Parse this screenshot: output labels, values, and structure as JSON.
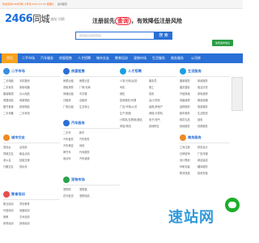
{
  "topbar": {
    "text": "欢迎来到2466同城 小号请 2021-07-09 星期六",
    "link": "设为首页"
  },
  "logo": {
    "brand": "2466",
    "tail": "同城"
  },
  "city": {
    "label": "· 曲阳 切换"
  },
  "banner": {
    "prefix": "注册前先",
    "highlight": "查询",
    "suffix": "，有效降低注册风险"
  },
  "search": {
    "placeholder": "搜索信息关键词查找",
    "button": "搜 索"
  },
  "post": {
    "label": "免费发布信息"
  },
  "nav": [
    "首页",
    "二手市场",
    "汽车服务",
    "房屋租售",
    "人才招聘",
    "城市交友",
    "教育培训",
    "宠物市场",
    "生活服务",
    "商务服务",
    "公司库"
  ],
  "sections": {
    "ershou": {
      "title": "二手市场",
      "links": [
        "二手电脑",
        "手机数码",
        "二手家具",
        "家用电器",
        "服装鞋帽",
        "办公用品",
        "母婴用品",
        "闲置物品",
        "图书音像",
        "其他物品",
        "二手设备",
        "二手家电"
      ]
    },
    "fangwu": {
      "title": "房屋租售",
      "links": [
        "房屋出租",
        "房屋出售",
        "求租求购",
        "厂房/仓库",
        "商铺出租",
        "写字楼",
        "日租房",
        "合租房",
        "厂房出租",
        "生意转让"
      ]
    },
    "rencai": {
      "title": "人才招聘",
      "links": [
        "人事/行政/后勤",
        "服务员",
        "司机",
        "普工",
        "销售",
        "保安",
        "招商服务/代理",
        "会计/财务",
        "广告/市场/公关",
        "建筑/房地产",
        "生产/制造",
        "网络/计算机",
        "计算机/互联网/通信",
        "电子/电气",
        "贸易/物流",
        "其他职位"
      ]
    },
    "shenghuo": {
      "title": "生活服务",
      "links": [
        "搬家服务",
        "家政服务",
        "婚庆摄影",
        "保洁清洗",
        "开锁换锁",
        "家电维修",
        "电脑维修",
        "管道疏通",
        "装修服务",
        "旅游服务",
        "租车服务",
        "生活配送",
        "鲜花礼品",
        "回收",
        "其他服务",
        "丧葬服务"
      ]
    },
    "jiaoyou": {
      "title": "城市交友",
      "links": [
        "男找女",
        "女找男",
        "同城交友",
        "聚会活动",
        "老乡会",
        "技能交换",
        "兴趣交友",
        "找玩伴"
      ]
    },
    "qiche": {
      "title": "汽车服务",
      "links": [
        "二手车",
        "新车",
        "汽车租赁",
        "汽车配件",
        "汽车美容",
        "驾校",
        "摩托车",
        "代驾服务",
        "电动车",
        "汽车维修"
      ]
    },
    "shangwu": {
      "title": "商务服务",
      "links": [
        "工商注册",
        "财务会计",
        "法律咨询",
        "广告传媒",
        "设计策划",
        "网站建设",
        "印刷包装",
        "翻译服务",
        "物流快递",
        "投资担保"
      ]
    },
    "jiaoyu": {
      "title": "教育培训",
      "links": [
        "职业培训",
        "学历教育",
        "外语培训",
        "电脑培训",
        "家教",
        "艺术培训",
        "体育培训",
        "其他培训"
      ]
    },
    "chongwu": {
      "title": "宠物市场",
      "links": [
        "宠物狗",
        "宠物猫",
        "花鸟鱼虫",
        "宠物用品"
      ]
    }
  },
  "watermark": "速站网",
  "colors": {
    "brand": "#2a6fd6",
    "active": "#f7a21b",
    "green": "#2a9d44",
    "red": "#e23"
  }
}
